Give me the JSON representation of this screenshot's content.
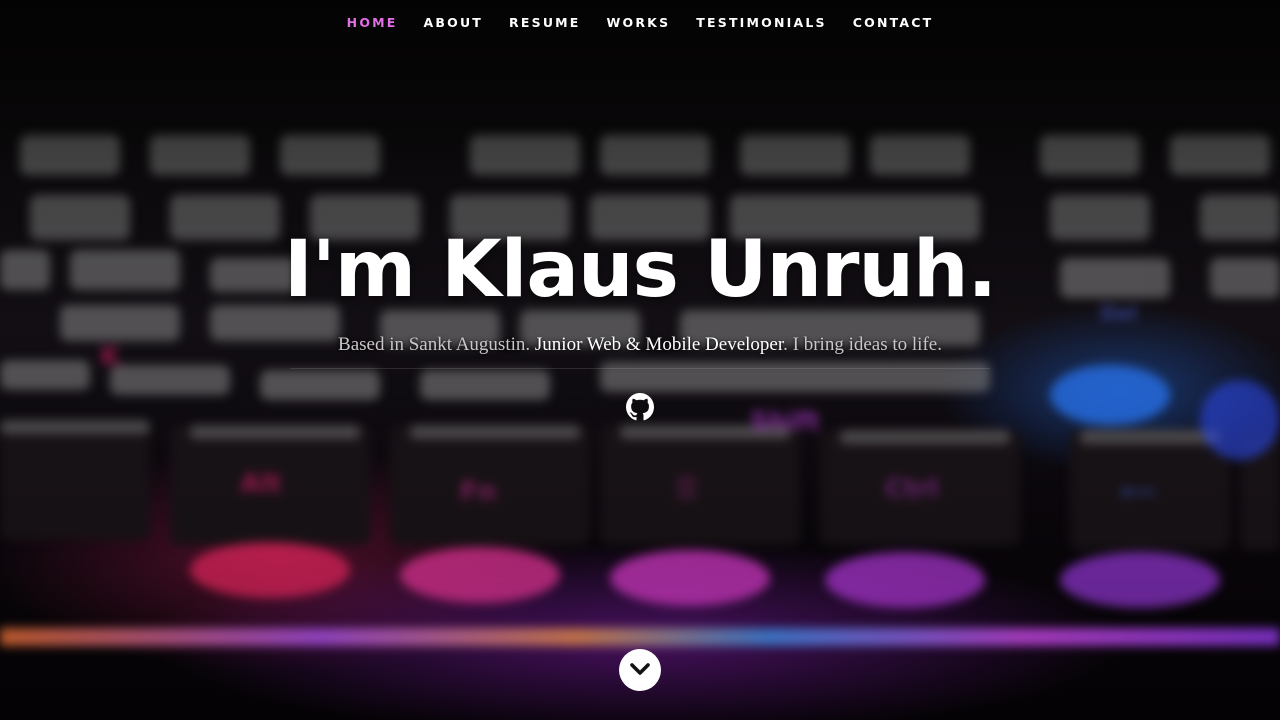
{
  "nav": {
    "items": [
      {
        "label": "HOME",
        "active": true
      },
      {
        "label": "ABOUT",
        "active": false
      },
      {
        "label": "RESUME",
        "active": false
      },
      {
        "label": "WORKS",
        "active": false
      },
      {
        "label": "TESTIMONIALS",
        "active": false
      },
      {
        "label": "CONTACT",
        "active": false
      }
    ],
    "active_color": "#e26ee6"
  },
  "banner": {
    "headline": "I'm Klaus Unruh.",
    "sub_prefix": "Based in Sankt Augustin. ",
    "sub_highlight": "Junior Web & Mobile Developer",
    "sub_suffix": ". I bring ideas to life."
  },
  "social": {
    "icons": [
      "github-icon"
    ]
  },
  "scroll": {
    "icon": "chevron-down-icon"
  },
  "background": {
    "description_colors": [
      "#ff2a8a",
      "#c93cff",
      "#3a7dff"
    ]
  }
}
